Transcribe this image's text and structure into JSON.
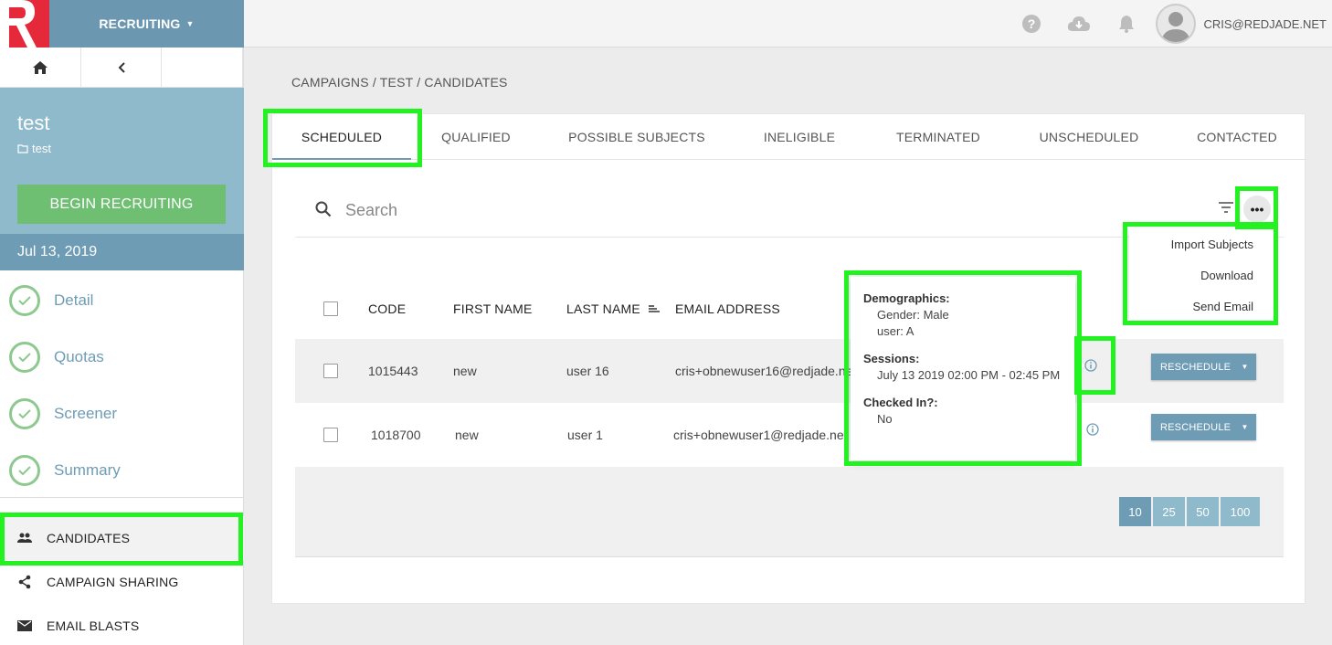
{
  "header": {
    "app_menu_label": "RECRUITING",
    "user_email": "CRIS@REDJADE.NET"
  },
  "sidebar": {
    "campaign_title": "test",
    "campaign_folder": "test",
    "begin_button": "BEGIN RECRUITING",
    "date": "Jul 13, 2019",
    "steps": [
      {
        "label": "Detail"
      },
      {
        "label": "Quotas"
      },
      {
        "label": "Screener"
      },
      {
        "label": "Summary"
      }
    ],
    "links": [
      {
        "label": "CANDIDATES",
        "icon": "people-icon",
        "active": true
      },
      {
        "label": "CAMPAIGN SHARING",
        "icon": "share-icon"
      },
      {
        "label": "EMAIL BLASTS",
        "icon": "mail-icon"
      }
    ]
  },
  "breadcrumb": "CAMPAIGNS / TEST / CANDIDATES",
  "tabs": [
    {
      "label": "SCHEDULED",
      "active": true
    },
    {
      "label": "QUALIFIED"
    },
    {
      "label": "POSSIBLE SUBJECTS"
    },
    {
      "label": "INELIGIBLE"
    },
    {
      "label": "TERMINATED"
    },
    {
      "label": "UNSCHEDULED"
    },
    {
      "label": "CONTACTED"
    }
  ],
  "search": {
    "placeholder": "Search",
    "more_label": "•••"
  },
  "table": {
    "columns": [
      "CODE",
      "FIRST NAME",
      "LAST NAME",
      "EMAIL ADDRESS"
    ],
    "rows": [
      {
        "code": "1015443",
        "first": "new",
        "last": "user 16",
        "email": "cris+obnewuser16@redjade.net",
        "action": "RESCHEDULE"
      },
      {
        "code": "1018700",
        "first": "new",
        "last": "user 1",
        "email": "cris+obnewuser1@redjade.net",
        "action": "RESCHEDULE"
      }
    ]
  },
  "pager": [
    "10",
    "25",
    "50",
    "100"
  ],
  "more_menu": [
    "Import Subjects",
    "Download",
    "Send Email"
  ],
  "popup": {
    "demographics_label": "Demographics:",
    "gender": "Gender: Male",
    "user": "user: A",
    "sessions_label": "Sessions:",
    "session": "July 13 2019 02:00 PM - 02:45 PM",
    "checked_in_label": "Checked In?:",
    "checked_in": "No"
  },
  "colors": {
    "brand_red": "#e5283a",
    "primary_blue": "#6e9cb4",
    "light_blue": "#8fbacb",
    "success_green": "#6fbf72",
    "highlight_green": "#22f21f"
  }
}
